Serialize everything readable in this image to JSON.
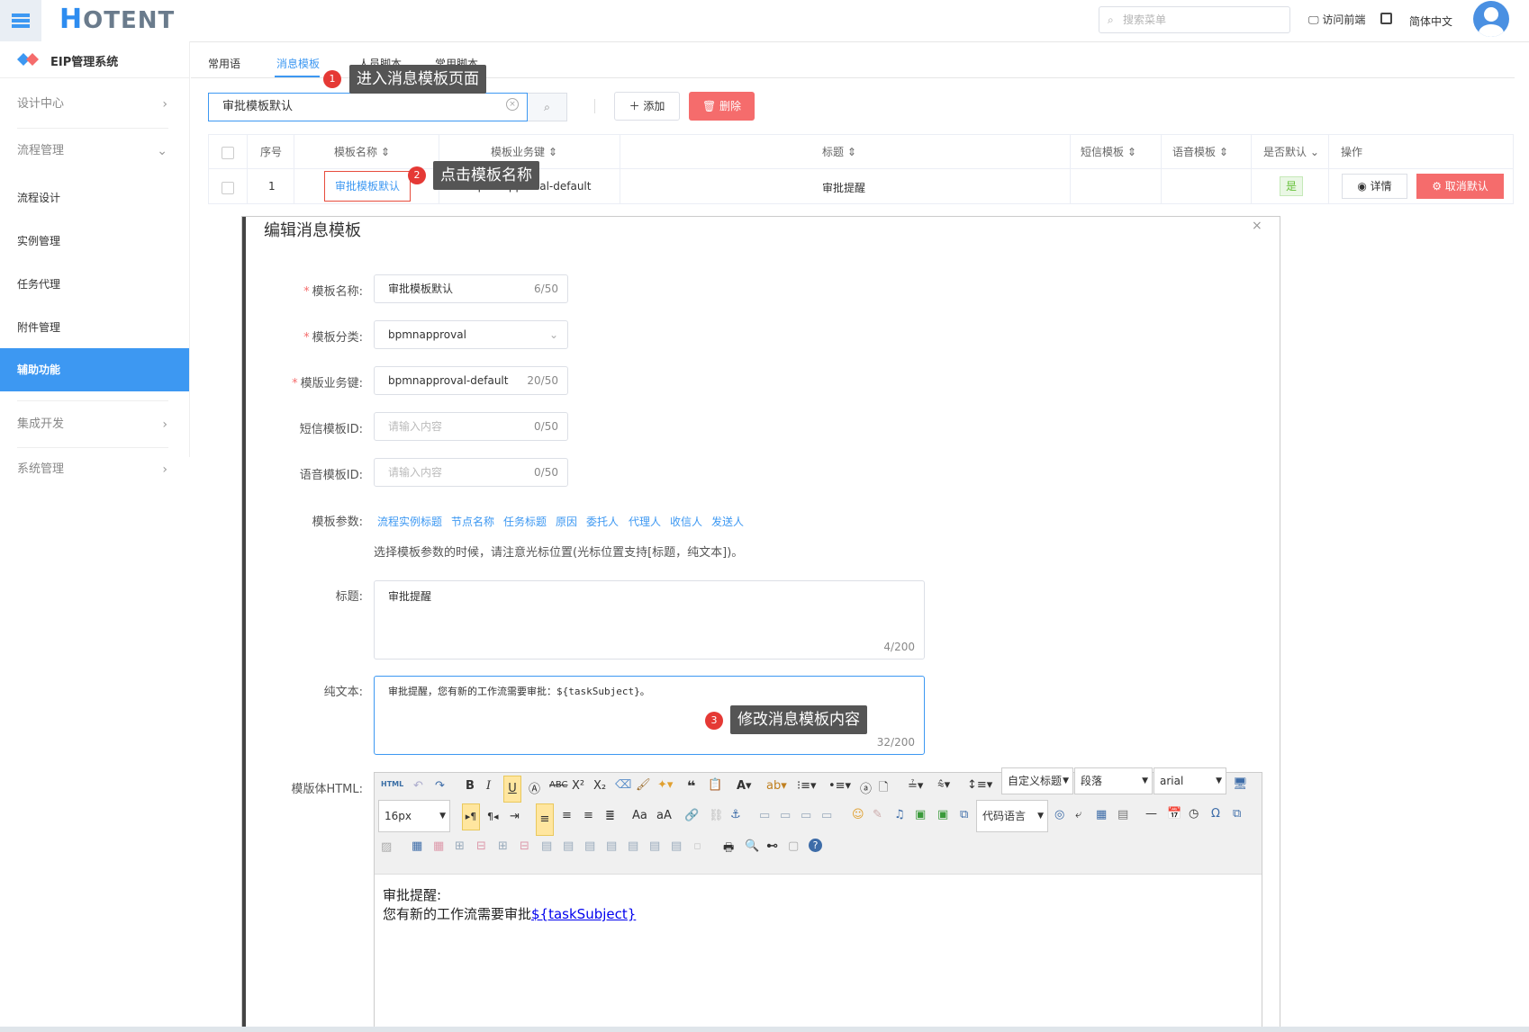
{
  "header": {
    "logo_h": "H",
    "logo_rest": "OTENT",
    "search_placeholder": "搜索菜单",
    "visit_front": "访问前端",
    "language": "简体中文"
  },
  "sidebar": {
    "system_title": "EIP管理系统",
    "items": [
      {
        "label": "设计中心"
      },
      {
        "label": "流程管理"
      },
      {
        "label": "流程设计"
      },
      {
        "label": "实例管理"
      },
      {
        "label": "任务代理"
      },
      {
        "label": "附件管理"
      },
      {
        "label": "辅助功能"
      },
      {
        "label": "集成开发"
      },
      {
        "label": "系统管理"
      }
    ]
  },
  "tabs": [
    "常用语",
    "消息模板",
    "人员脚本",
    "常用脚本"
  ],
  "toolbar": {
    "search_value": "审批模板默认",
    "add_label": "添加",
    "delete_label": "删除"
  },
  "table": {
    "headers": [
      "序号",
      "模板名称",
      "模板业务键",
      "标题",
      "短信模板",
      "语音模板",
      "是否默认",
      "操作"
    ],
    "row": {
      "index": "1",
      "name": "审批模板默认",
      "business_key": "bpmnapproval-default",
      "title": "审批提醒",
      "is_default": "是",
      "detail_label": "详情",
      "cancel_default_label": "取消默认"
    }
  },
  "callouts": [
    {
      "num": "1",
      "text": "进入消息模板页面"
    },
    {
      "num": "2",
      "text": "点击模板名称"
    },
    {
      "num": "3",
      "text": "修改消息模板内容"
    }
  ],
  "dialog": {
    "title": "编辑消息模板",
    "labels": {
      "name": "模板名称:",
      "category": "模板分类:",
      "business_key": "模版业务键:",
      "sms_id": "短信模板ID:",
      "voice_id": "语音模板ID:",
      "params": "模板参数:",
      "subject": "标题:",
      "plain": "纯文本:",
      "html": "模版体HTML:"
    },
    "name_value": "审批模板默认",
    "name_count": "6/50",
    "category_value": "bpmnapproval",
    "key_value": "bpmnapproval-default",
    "key_count": "20/50",
    "sms_placeholder": "请输入内容",
    "sms_count": "0/50",
    "voice_placeholder": "请输入内容",
    "voice_count": "0/50",
    "params": [
      "流程实例标题",
      "节点名称",
      "任务标题",
      "原因",
      "委托人",
      "代理人",
      "收信人",
      "发送人"
    ],
    "param_hint": "选择模板参数的时候，请注意光标位置(光标位置支持[标题，纯文本])。",
    "subject_value": "审批提醒",
    "subject_count": "4/200",
    "plain_value": "审批提醒，您有新的工作流需要审批：${taskSubject}。",
    "plain_count": "32/200"
  },
  "editor": {
    "heading_select": "自定义标题",
    "paragraph_select": "段落",
    "font_select": "arial",
    "size_select": "16px",
    "code_lang_select": "代码语言",
    "content_line1": "审批提醒:",
    "content_line2": "您有新的工作流需要审批",
    "content_link": "${taskSubject}"
  }
}
